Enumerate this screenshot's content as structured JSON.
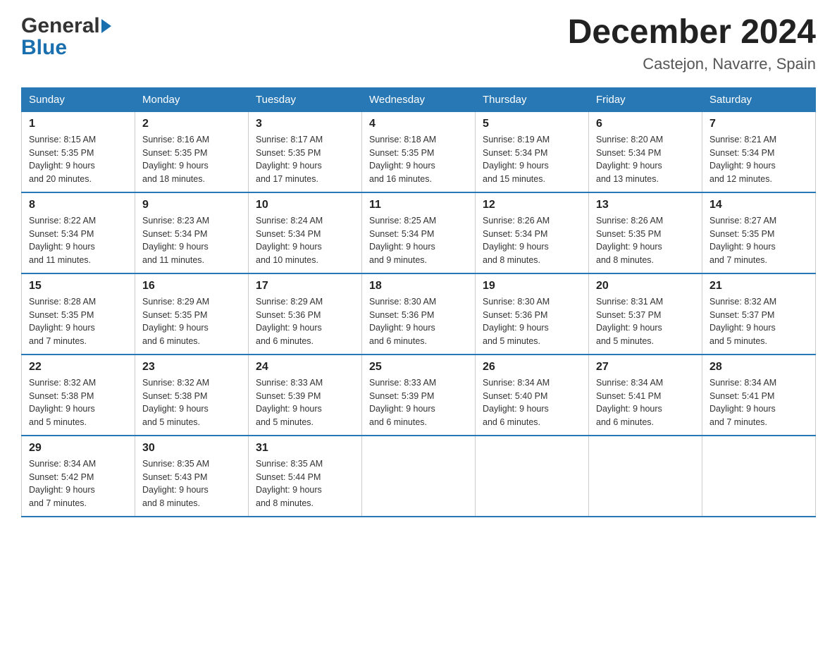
{
  "header": {
    "logo_text_general": "General",
    "logo_text_blue": "Blue",
    "month_title": "December 2024",
    "location": "Castejon, Navarre, Spain"
  },
  "days_of_week": [
    "Sunday",
    "Monday",
    "Tuesday",
    "Wednesday",
    "Thursday",
    "Friday",
    "Saturday"
  ],
  "weeks": [
    [
      {
        "day": "1",
        "sunrise": "8:15 AM",
        "sunset": "5:35 PM",
        "daylight": "9 hours and 20 minutes."
      },
      {
        "day": "2",
        "sunrise": "8:16 AM",
        "sunset": "5:35 PM",
        "daylight": "9 hours and 18 minutes."
      },
      {
        "day": "3",
        "sunrise": "8:17 AM",
        "sunset": "5:35 PM",
        "daylight": "9 hours and 17 minutes."
      },
      {
        "day": "4",
        "sunrise": "8:18 AM",
        "sunset": "5:35 PM",
        "daylight": "9 hours and 16 minutes."
      },
      {
        "day": "5",
        "sunrise": "8:19 AM",
        "sunset": "5:34 PM",
        "daylight": "9 hours and 15 minutes."
      },
      {
        "day": "6",
        "sunrise": "8:20 AM",
        "sunset": "5:34 PM",
        "daylight": "9 hours and 13 minutes."
      },
      {
        "day": "7",
        "sunrise": "8:21 AM",
        "sunset": "5:34 PM",
        "daylight": "9 hours and 12 minutes."
      }
    ],
    [
      {
        "day": "8",
        "sunrise": "8:22 AM",
        "sunset": "5:34 PM",
        "daylight": "9 hours and 11 minutes."
      },
      {
        "day": "9",
        "sunrise": "8:23 AM",
        "sunset": "5:34 PM",
        "daylight": "9 hours and 11 minutes."
      },
      {
        "day": "10",
        "sunrise": "8:24 AM",
        "sunset": "5:34 PM",
        "daylight": "9 hours and 10 minutes."
      },
      {
        "day": "11",
        "sunrise": "8:25 AM",
        "sunset": "5:34 PM",
        "daylight": "9 hours and 9 minutes."
      },
      {
        "day": "12",
        "sunrise": "8:26 AM",
        "sunset": "5:34 PM",
        "daylight": "9 hours and 8 minutes."
      },
      {
        "day": "13",
        "sunrise": "8:26 AM",
        "sunset": "5:35 PM",
        "daylight": "9 hours and 8 minutes."
      },
      {
        "day": "14",
        "sunrise": "8:27 AM",
        "sunset": "5:35 PM",
        "daylight": "9 hours and 7 minutes."
      }
    ],
    [
      {
        "day": "15",
        "sunrise": "8:28 AM",
        "sunset": "5:35 PM",
        "daylight": "9 hours and 7 minutes."
      },
      {
        "day": "16",
        "sunrise": "8:29 AM",
        "sunset": "5:35 PM",
        "daylight": "9 hours and 6 minutes."
      },
      {
        "day": "17",
        "sunrise": "8:29 AM",
        "sunset": "5:36 PM",
        "daylight": "9 hours and 6 minutes."
      },
      {
        "day": "18",
        "sunrise": "8:30 AM",
        "sunset": "5:36 PM",
        "daylight": "9 hours and 6 minutes."
      },
      {
        "day": "19",
        "sunrise": "8:30 AM",
        "sunset": "5:36 PM",
        "daylight": "9 hours and 5 minutes."
      },
      {
        "day": "20",
        "sunrise": "8:31 AM",
        "sunset": "5:37 PM",
        "daylight": "9 hours and 5 minutes."
      },
      {
        "day": "21",
        "sunrise": "8:32 AM",
        "sunset": "5:37 PM",
        "daylight": "9 hours and 5 minutes."
      }
    ],
    [
      {
        "day": "22",
        "sunrise": "8:32 AM",
        "sunset": "5:38 PM",
        "daylight": "9 hours and 5 minutes."
      },
      {
        "day": "23",
        "sunrise": "8:32 AM",
        "sunset": "5:38 PM",
        "daylight": "9 hours and 5 minutes."
      },
      {
        "day": "24",
        "sunrise": "8:33 AM",
        "sunset": "5:39 PM",
        "daylight": "9 hours and 5 minutes."
      },
      {
        "day": "25",
        "sunrise": "8:33 AM",
        "sunset": "5:39 PM",
        "daylight": "9 hours and 6 minutes."
      },
      {
        "day": "26",
        "sunrise": "8:34 AM",
        "sunset": "5:40 PM",
        "daylight": "9 hours and 6 minutes."
      },
      {
        "day": "27",
        "sunrise": "8:34 AM",
        "sunset": "5:41 PM",
        "daylight": "9 hours and 6 minutes."
      },
      {
        "day": "28",
        "sunrise": "8:34 AM",
        "sunset": "5:41 PM",
        "daylight": "9 hours and 7 minutes."
      }
    ],
    [
      {
        "day": "29",
        "sunrise": "8:34 AM",
        "sunset": "5:42 PM",
        "daylight": "9 hours and 7 minutes."
      },
      {
        "day": "30",
        "sunrise": "8:35 AM",
        "sunset": "5:43 PM",
        "daylight": "9 hours and 8 minutes."
      },
      {
        "day": "31",
        "sunrise": "8:35 AM",
        "sunset": "5:44 PM",
        "daylight": "9 hours and 8 minutes."
      },
      null,
      null,
      null,
      null
    ]
  ],
  "labels": {
    "sunrise": "Sunrise:",
    "sunset": "Sunset:",
    "daylight": "Daylight:"
  }
}
